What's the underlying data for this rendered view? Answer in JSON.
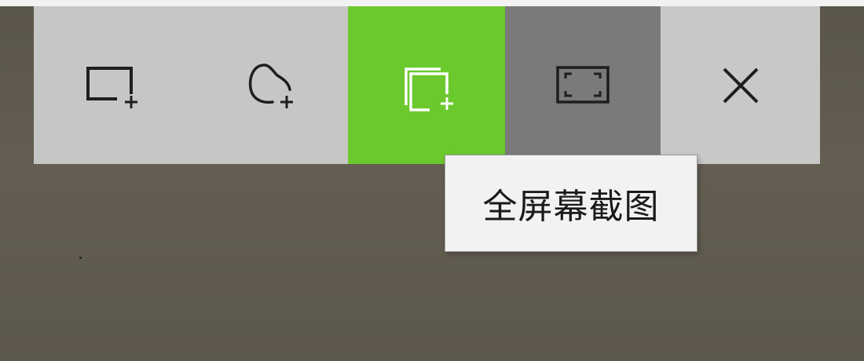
{
  "snip_toolbar": {
    "tools": [
      {
        "id": "rectangular",
        "icon": "rectangle-snip-icon",
        "state": "normal"
      },
      {
        "id": "freeform",
        "icon": "freeform-snip-icon",
        "state": "normal"
      },
      {
        "id": "window",
        "icon": "window-snip-icon",
        "state": "selected"
      },
      {
        "id": "fullscreen",
        "icon": "fullscreen-snip-icon",
        "state": "hover"
      },
      {
        "id": "close",
        "icon": "close-icon",
        "state": "normal"
      }
    ],
    "colors": {
      "toolbar_bg": "#c6c6c6",
      "selected_bg": "#6cc92d",
      "hover_bg": "#7a7a7a",
      "icon_dark": "#1e1e1e",
      "icon_on_selected": "#ffffff"
    }
  },
  "tooltip": {
    "text": "全屏幕截图"
  }
}
